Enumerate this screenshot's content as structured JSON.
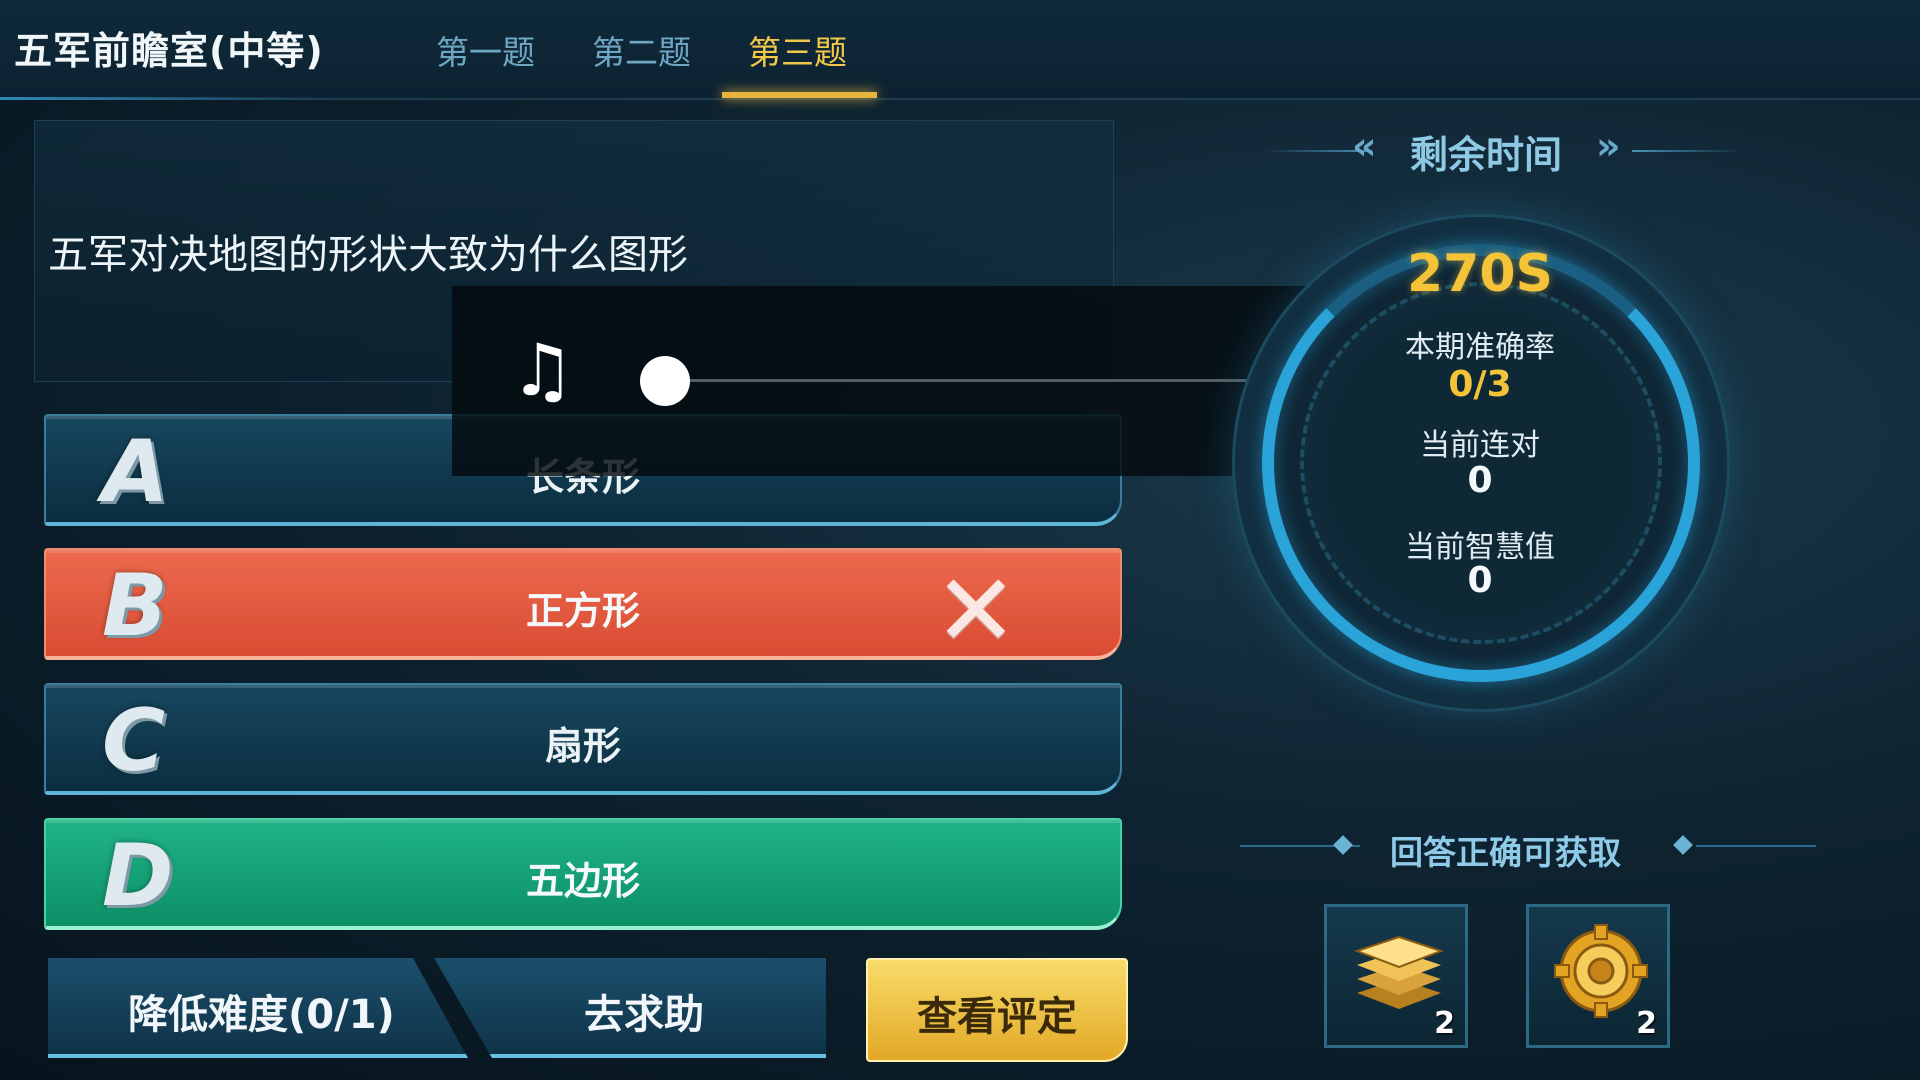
{
  "header": {
    "title": "五军前瞻室(中等)",
    "tabs": [
      {
        "label": "第一题",
        "active": false
      },
      {
        "label": "第二题",
        "active": false
      },
      {
        "label": "第三题",
        "active": true
      }
    ]
  },
  "question": {
    "text": "五军对决地图的形状大致为什么图形"
  },
  "music_player": {
    "icon": "music-note-icon",
    "progress": 0
  },
  "options": [
    {
      "letter": "A",
      "label": "长条形",
      "state": "normal"
    },
    {
      "letter": "B",
      "label": "正方形",
      "state": "wrong"
    },
    {
      "letter": "C",
      "label": "扇形",
      "state": "normal"
    },
    {
      "letter": "D",
      "label": "五边形",
      "state": "correct"
    }
  ],
  "buttons": {
    "ease_label": "降低难度(0/1)",
    "help_label": "去求助",
    "rating_label": "查看评定"
  },
  "timer": {
    "title": "剩余时间",
    "value": "270S"
  },
  "stats": {
    "accuracy_label": "本期准确率",
    "accuracy_value": "0/3",
    "streak_label": "当前连对",
    "streak_value": "0",
    "wisdom_label": "当前智慧值",
    "wisdom_value": "0"
  },
  "rewards": {
    "title": "回答正确可获取",
    "items": [
      {
        "icon": "gold-stack-icon",
        "count": "2"
      },
      {
        "icon": "gear-coin-icon",
        "count": "2"
      }
    ]
  },
  "colors": {
    "accent_gold": "#f4c338",
    "wrong_red": "#e35a3f",
    "correct_green": "#14a277",
    "ring_blue": "#2aa3d8"
  }
}
